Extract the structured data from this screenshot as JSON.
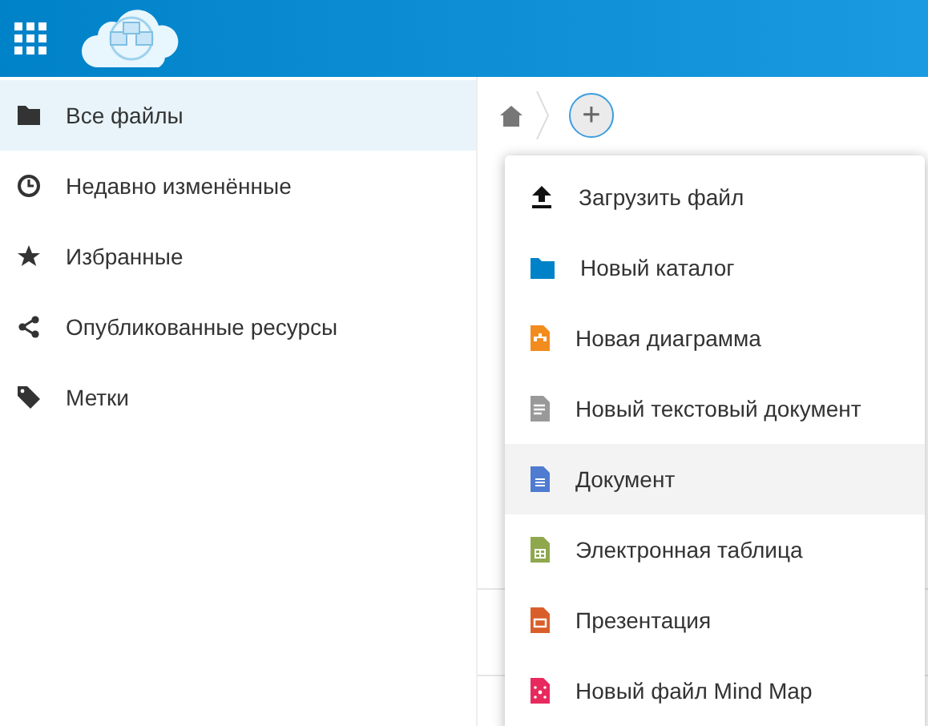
{
  "sidebar": {
    "items": [
      {
        "label": "Все файлы",
        "kind": "folder",
        "selected": true
      },
      {
        "label": "Недавно изменённые",
        "kind": "clock",
        "selected": false
      },
      {
        "label": "Избранные",
        "kind": "star",
        "selected": false
      },
      {
        "label": "Опубликованные ресурсы",
        "kind": "share",
        "selected": false
      },
      {
        "label": "Метки",
        "kind": "tag",
        "selected": false
      }
    ]
  },
  "new_menu": {
    "button": "+",
    "items": [
      {
        "label": "Загрузить файл",
        "kind": "upload",
        "highlighted": false
      },
      {
        "label": "Новый каталог",
        "kind": "folder",
        "highlighted": false
      },
      {
        "label": "Новая диаграмма",
        "kind": "diagram",
        "highlighted": false
      },
      {
        "label": "Новый текстовый документ",
        "kind": "text",
        "highlighted": false
      },
      {
        "label": "Документ",
        "kind": "document",
        "highlighted": true
      },
      {
        "label": "Электронная таблица",
        "kind": "spreadsheet",
        "highlighted": false
      },
      {
        "label": "Презентация",
        "kind": "presentation",
        "highlighted": false
      },
      {
        "label": "Новый файл Mind Map",
        "kind": "mindmap",
        "highlighted": false
      }
    ]
  }
}
